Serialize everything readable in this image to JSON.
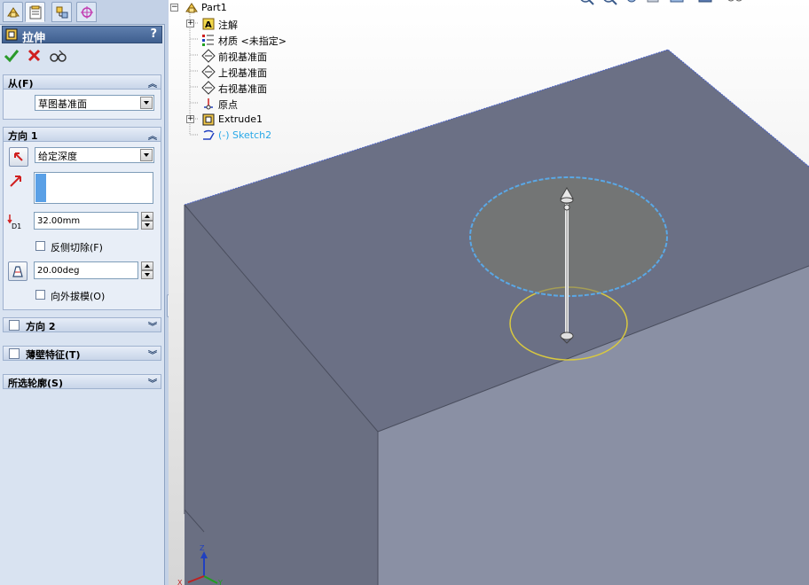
{
  "pm": {
    "title": "拉伸",
    "help": "?",
    "from_group": {
      "title": "从(F)",
      "start_condition": "草图基准面"
    },
    "direction1": {
      "title": "方向 1",
      "end_condition": "给定深度",
      "depth": "32.00mm",
      "depth_label": "D1",
      "reverse_cut_label": "反侧切除(F)",
      "draft_angle": "20.00deg",
      "draft_outward_label": "向外拔模(O)"
    },
    "direction2": {
      "title": "方向 2"
    },
    "thin_feature": {
      "title": "薄壁特征(T)"
    },
    "selected_contours": {
      "title": "所选轮廓(S)"
    }
  },
  "tree": {
    "root": "Part1",
    "items": [
      {
        "label": "注解"
      },
      {
        "label": "材质 <未指定>"
      },
      {
        "label": "前视基准面"
      },
      {
        "label": "上视基准面"
      },
      {
        "label": "右视基准面"
      },
      {
        "label": "原点"
      },
      {
        "label": "Extrude1"
      },
      {
        "label": "(-) Sketch2"
      }
    ]
  },
  "triad": {
    "z": "Z",
    "y": "Y",
    "x": "X"
  },
  "colors": {
    "box_top": "#6b7085",
    "box_left": "#6a6f82",
    "box_right": "#8a90a4",
    "edge": "#4a62c8",
    "sketch_blue": "#5aa8e6",
    "sketch_yellow": "#d8c840",
    "pm_title": "#4a6a9c",
    "ok_green": "#2a9a2a",
    "cancel_red": "#d02020"
  }
}
